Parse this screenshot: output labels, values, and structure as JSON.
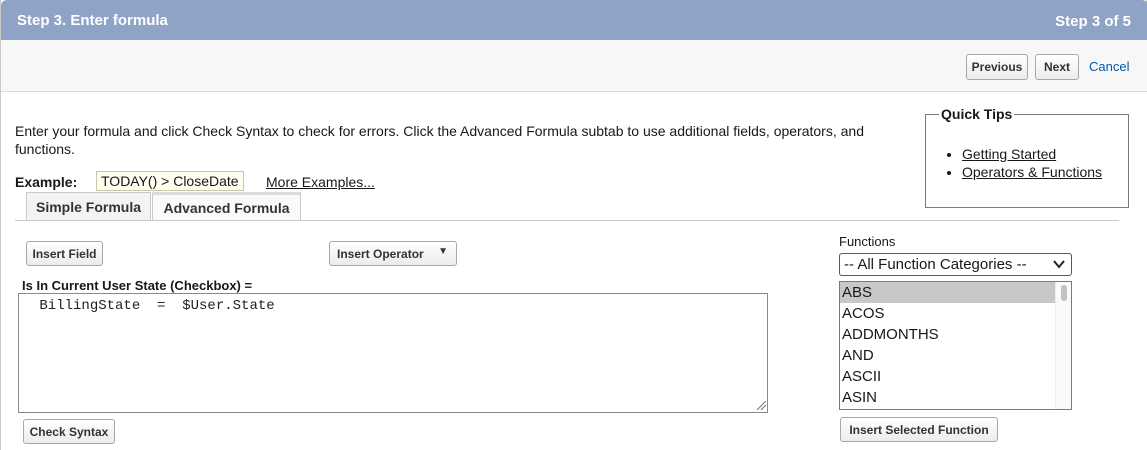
{
  "header": {
    "title": "Step 3. Enter formula",
    "step": "Step 3 of 5"
  },
  "toolbar": {
    "previous": "Previous",
    "next": "Next",
    "cancel": "Cancel"
  },
  "intro": "Enter your formula and click Check Syntax to check for errors. Click the Advanced Formula subtab to use additional fields, operators, and functions.",
  "example": {
    "label": "Example:",
    "code": "TODAY() > CloseDate",
    "more": "More Examples..."
  },
  "quick_tips": {
    "title": "Quick Tips",
    "items": [
      "Getting Started",
      "Operators & Functions"
    ]
  },
  "tabs": {
    "simple": "Simple Formula",
    "advanced": "Advanced Formula"
  },
  "editor": {
    "insert_field": "Insert Field",
    "insert_operator": "Insert Operator",
    "field_label": "Is In Current User State (Checkbox) =",
    "formula": " BillingState  =  $User.State",
    "check_syntax": "Check Syntax"
  },
  "functions": {
    "label": "Functions",
    "category": "-- All Function Categories --",
    "items": [
      "ABS",
      "ACOS",
      "ADDMONTHS",
      "AND",
      "ASCII",
      "ASIN"
    ],
    "selected": "ABS",
    "insert": "Insert Selected Function"
  },
  "colors": {
    "header": "#8fa3c6",
    "link": "#015ba7",
    "selection": "#c8c8c8"
  }
}
